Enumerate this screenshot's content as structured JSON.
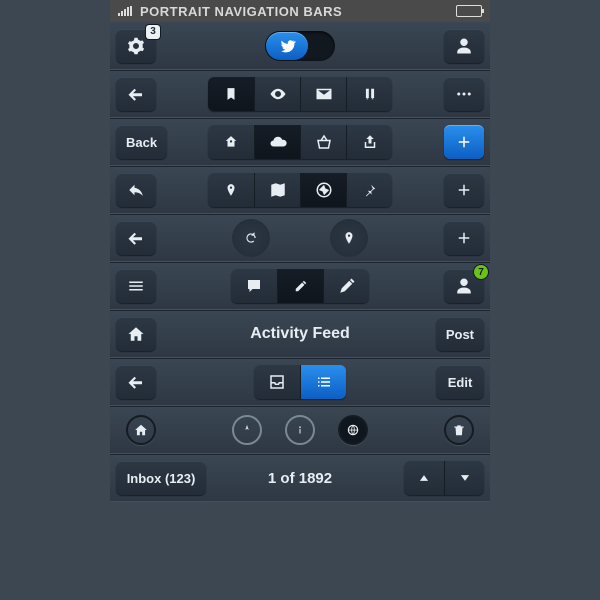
{
  "colors": {
    "accent_blue": "#1e79dc",
    "badge_green": "#6cc01b"
  },
  "status": {
    "title": "PORTRAIT NAVIGATION BARS"
  },
  "rows": {
    "r1": {
      "settings_badge": "3"
    },
    "r2": {},
    "r3": {
      "back_label": "Back"
    },
    "r7": {
      "user_badge": "7"
    },
    "r8": {
      "title": "Activity Feed",
      "post_label": "Post"
    },
    "r9": {
      "edit_label": "Edit"
    },
    "r11": {
      "inbox_label": "Inbox (123)",
      "pager": "1 of 1892"
    }
  }
}
